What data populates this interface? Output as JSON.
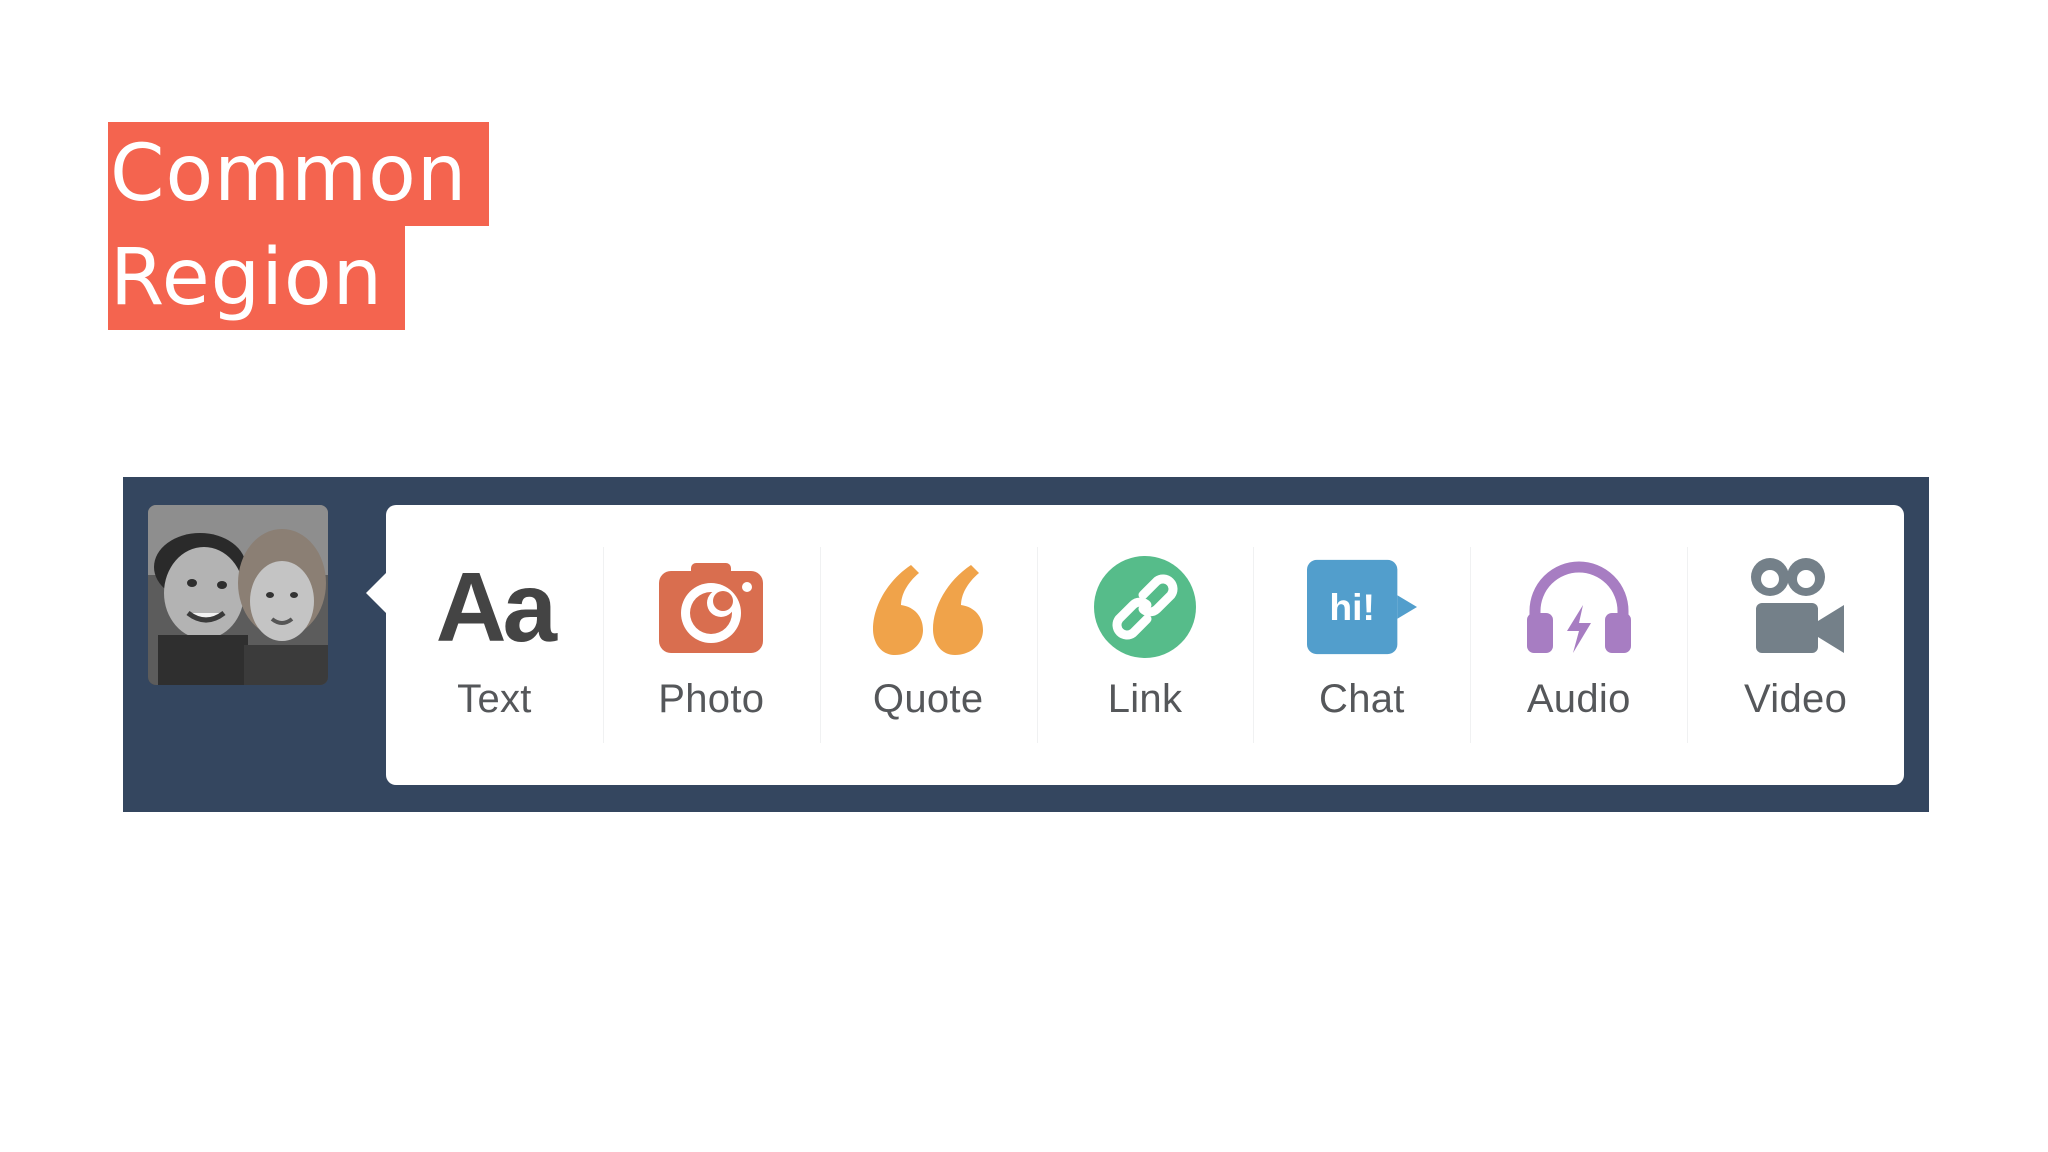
{
  "slide": {
    "title_line1": "Common",
    "title_line2": "Region",
    "highlight_color": "#f4644f"
  },
  "dashboard": {
    "bar_color": "#34465f",
    "avatar": {
      "icon": "user-avatar-photo"
    },
    "post_types": [
      {
        "label": "Text",
        "icon": "text-aa-icon",
        "icon_text": "Aa",
        "color": "#444444"
      },
      {
        "label": "Photo",
        "icon": "camera-icon",
        "color": "#d96e4f"
      },
      {
        "label": "Quote",
        "icon": "quote-icon",
        "icon_text": "“",
        "color": "#f0a34a"
      },
      {
        "label": "Link",
        "icon": "link-icon",
        "color": "#56bc8a"
      },
      {
        "label": "Chat",
        "icon": "chat-bubble-icon",
        "icon_text": "hi!",
        "color": "#529ecc"
      },
      {
        "label": "Audio",
        "icon": "headphones-icon",
        "color": "#a77dc2"
      },
      {
        "label": "Video",
        "icon": "video-camera-icon",
        "color": "#748089"
      }
    ]
  }
}
